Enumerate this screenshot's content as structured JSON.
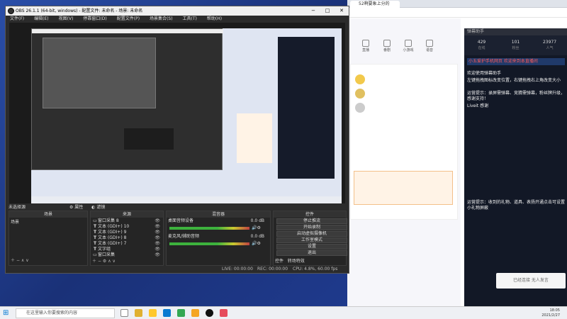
{
  "browser": {
    "tab_title": "52啊要象上分的",
    "nav_items": [
      "直播",
      "番剧",
      "小游戏",
      "语音"
    ]
  },
  "obs": {
    "title": "OBS 26.1.1 (64-bit, windows) - 配置文件: 未命名 - 场景: 未命名",
    "menu": [
      "文件(F)",
      "编辑(E)",
      "视图(V)",
      "停靠窗口(D)",
      "配置文件(P)",
      "场景集合(S)",
      "工具(T)",
      "帮助(H)"
    ],
    "no_source_selected": "未选择源",
    "props_label": "属性",
    "filters_label": "滤镜",
    "docks": {
      "scenes": {
        "title": "场景",
        "items": [
          "场景"
        ]
      },
      "sources": {
        "title": "来源",
        "items": [
          "窗口采集 8",
          "文本 (GDI+) 10",
          "文本 (GDI+) 9",
          "文本 (GDI+) 8",
          "文本 (GDI+) 7",
          "文字组",
          "窗口采集"
        ]
      },
      "mixer": {
        "title": "混音器",
        "tracks": [
          {
            "name": "桌面音频设备",
            "db": "0.0 dB"
          },
          {
            "name": "麦克风/辅助音频",
            "db": "0.0 dB"
          }
        ]
      },
      "controls": {
        "title": "控件",
        "buttons": [
          "停止推流",
          "开始录制",
          "启动虚拟摄像机",
          "工作室模式",
          "设置",
          "退出"
        ]
      },
      "tabs": [
        "控件",
        "转场特效"
      ]
    },
    "status": {
      "live": "LIVE: 00:00:00",
      "rec": "REC: 00:00:00",
      "cpu": "CPU: 4.8%, 60.00 fps"
    }
  },
  "live_panel": {
    "header": "弹幕助手",
    "stats": [
      {
        "value": "429",
        "label": "在线"
      },
      {
        "value": "101",
        "label": "粉丝"
      },
      {
        "value": "23977",
        "label": "人气"
      }
    ],
    "messages": [
      {
        "text": "小五爱护手机网页 欢迎来到本直播间",
        "highlight": true
      },
      {
        "text": "欢迎使用弹幕助手",
        "highlight": false
      },
      {
        "text": "左键拖拽图标改变位置，右键拖拽右上角改变大小",
        "highlight": false
      },
      {
        "text": "运营提示：录屏需弹幕、竞猜需弹幕，粉丝牌升级，感谢支持！",
        "highlight": false
      },
      {
        "text": "Liveit 感谢",
        "highlight": false
      },
      {
        "text": "运营提示：收到的礼物、道具、表扬开通点击可设置小礼物屏蔽",
        "highlight": false
      }
    ],
    "toast": "已经连接 无人发言"
  },
  "taskbar": {
    "search_placeholder": "在这里输入你要搜索的内容",
    "time": "18:05",
    "date": "2021/2/27"
  },
  "colors": {
    "obs_bg": "#2b2b2b",
    "accent_red": "#ff5a5a",
    "live_bg": "#121826",
    "desktop_blue": "#1f3f8f"
  }
}
